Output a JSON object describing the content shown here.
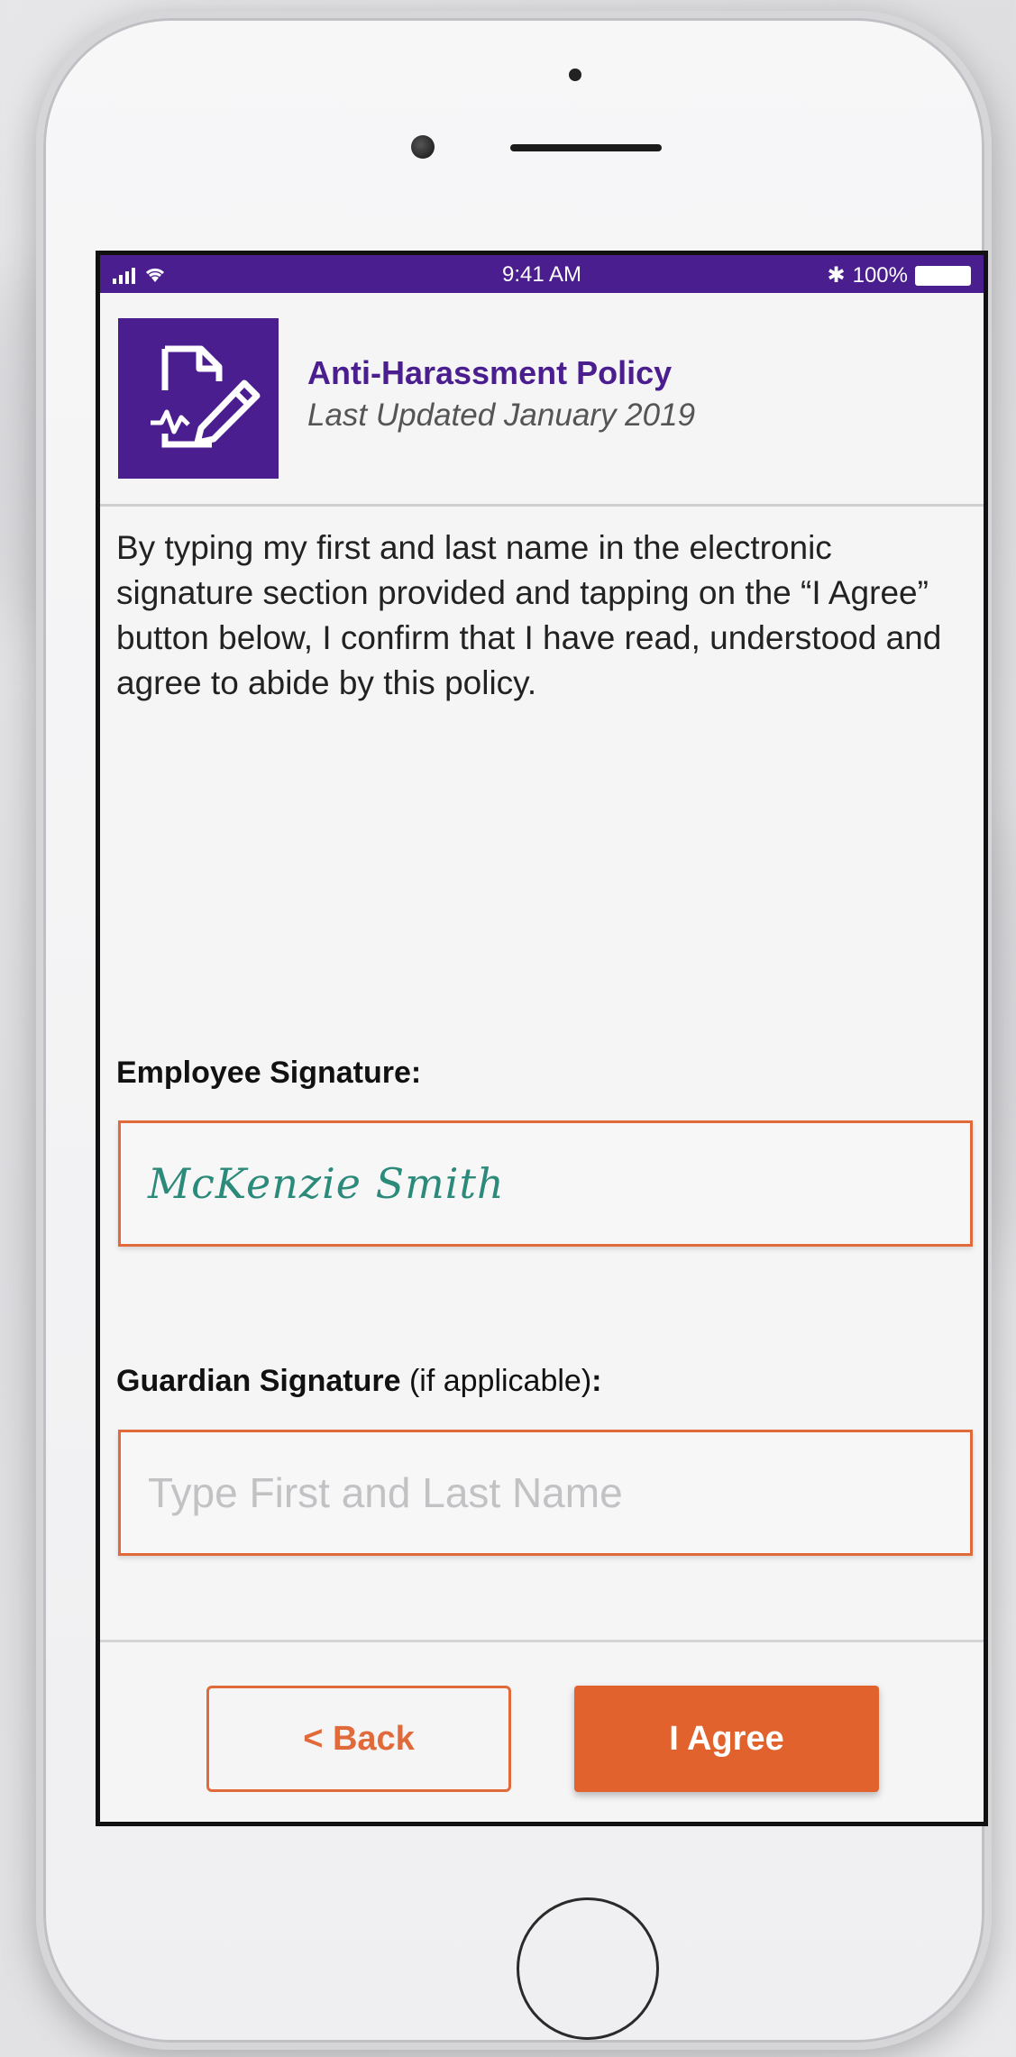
{
  "status_bar": {
    "time": "9:41 AM",
    "battery": "100%"
  },
  "header": {
    "title": "Anti-Harassment Policy",
    "subtitle": "Last Updated January 2019",
    "icon": "document-signature-icon"
  },
  "agreement_text": "By typing my first and last name in the electronic signature section provided and tapping on the “I Agree” button below, I confirm that I have read, understood and agree to abide by this policy.",
  "employee_signature": {
    "label": "Employee Signature:",
    "value": "McKenzie Smith"
  },
  "guardian_signature": {
    "label_bold": "Guardian Signature",
    "label_note": "(if applicable)",
    "label_colon": ":",
    "placeholder": "Type First and Last Name"
  },
  "buttons": {
    "back": "< Back",
    "agree": "I Agree"
  },
  "colors": {
    "brand_purple": "#4a1e8f",
    "accent_orange": "#e2622d",
    "signature_teal": "#2b8a7a"
  }
}
